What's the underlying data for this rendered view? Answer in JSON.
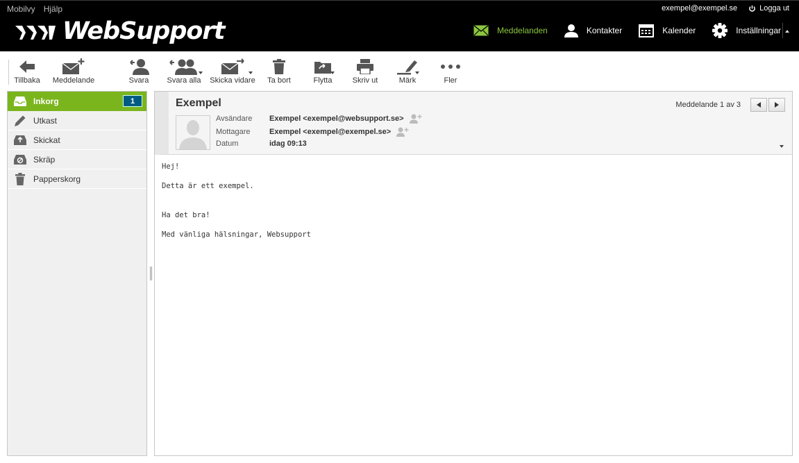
{
  "top_links": {
    "mobile": "Mobilvy",
    "help": "Hjälp"
  },
  "user": {
    "email": "exempel@exempel.se",
    "logout": "Logga ut"
  },
  "logo": {
    "text": "WebSupport"
  },
  "nav": {
    "messages": "Meddelanden",
    "contacts": "Kontakter",
    "calendar": "Kalender",
    "settings": "Inställningar"
  },
  "toolbar": {
    "back": "Tillbaka",
    "compose": "Meddelande",
    "reply": "Svara",
    "reply_all": "Svara alla",
    "forward": "Skicka vidare",
    "delete": "Ta bort",
    "move": "Flytta",
    "print": "Skriv ut",
    "mark": "Märk",
    "more": "Fler"
  },
  "folders": [
    {
      "label": "Inkorg",
      "count": "1",
      "icon": "inbox-icon"
    },
    {
      "label": "Utkast",
      "icon": "pencil-icon"
    },
    {
      "label": "Skickat",
      "icon": "sent-icon"
    },
    {
      "label": "Skräp",
      "icon": "junk-icon"
    },
    {
      "label": "Papperskorg",
      "icon": "trash-icon"
    }
  ],
  "message": {
    "subject": "Exempel",
    "pager": "Meddelande 1 av 3",
    "from_label": "Avsändare",
    "from": "Exempel <exempel@websupport.se>",
    "to_label": "Mottagare",
    "to": "Exempel <exempel@exempel.se>",
    "date_label": "Datum",
    "date": "idag 09:13",
    "body": {
      "line1": "Hej!",
      "line2": "Detta är ett exempel.",
      "line3": "Ha det bra!",
      "line4": "Med vänliga hälsningar, Websupport"
    }
  },
  "colors": {
    "accent": "#7ab51d",
    "badge": "#005b82",
    "header_bg": "#000000"
  }
}
